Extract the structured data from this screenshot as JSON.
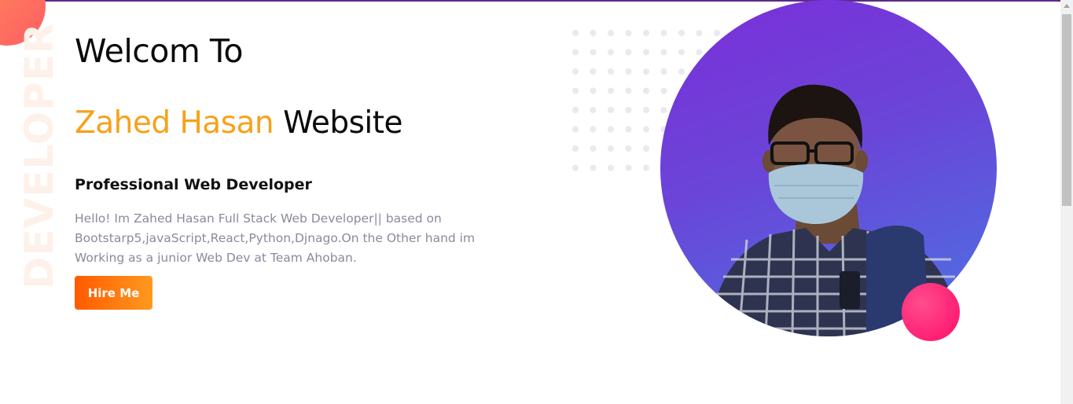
{
  "hero": {
    "side_word": "DEVELOPER",
    "title_line_1": "Welcom To",
    "name_highlight": "Zahed Hasan",
    "title_rest": "Website",
    "subtitle": "Professional Web Developer",
    "bio": "Hello! Im Zahed Hasan Full Stack Web Developer|| based on Bootstarp5,javaScript,React,Python,Djnago.On the Other hand im Working as a junior Web Dev at Team Ahoban.",
    "cta_label": "Hire Me"
  },
  "colors": {
    "accent": "#f6a21b",
    "cta_start": "#ff5a00",
    "cta_end": "#ff9a1f",
    "circle_start": "#7b2fd9",
    "circle_end": "#4b73e2",
    "pink_ball": "#ff1f74",
    "corner_blob": "#ff5e62"
  },
  "image": {
    "portrait_subject": "man wearing glasses, blue face mask, plaid shirt and backpack strap"
  }
}
